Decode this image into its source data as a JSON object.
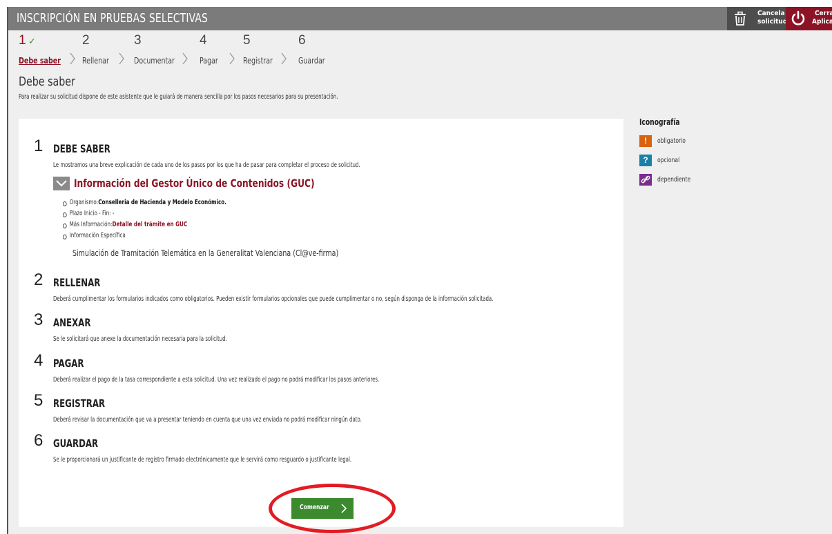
{
  "app": {
    "title": "INSCRIPCIÓN EN PRUEBAS SELECTIVAS",
    "cancel_label_1": "Cancela",
    "cancel_label_2": "solicitud",
    "close_label_1": "Cerrar",
    "close_label_2": "Aplicación"
  },
  "steps": [
    {
      "number": "1",
      "name": "Debe saber",
      "done": true
    },
    {
      "number": "2",
      "name": "Rellenar"
    },
    {
      "number": "3",
      "name": "Documentar"
    },
    {
      "number": "4",
      "name": "Pagar"
    },
    {
      "number": "5",
      "name": "Registrar"
    },
    {
      "number": "6",
      "name": "Guardar"
    }
  ],
  "page": {
    "title": "Debe saber",
    "description": "Para realizar su solicitud dispone de este asistente que le guiará de manera sencilla por los pasos necesarios para su presentación."
  },
  "sections": [
    {
      "number": "1",
      "title": "DEBE SABER",
      "description": "Le mostramos una breve explicación de cada uno de los pasos por los que ha de pasar para completar el proceso de solicitud."
    },
    {
      "number": "2",
      "title": "RELLENAR",
      "description": "Deberá cumplimentar los formularios indicados como obligatorios. Pueden existir formularios opcionales que puede cumplimentar o no, según disponga de la información solicitada."
    },
    {
      "number": "3",
      "title": "ANEXAR",
      "description": "Se le solicitará que anexe la documentación necesaria para la solicitud."
    },
    {
      "number": "4",
      "title": "PAGAR",
      "description": "Deberá realizar el pago de la tasa correspondiente a esta solicitud. Una vez realizado el pago no podrá modificar los pasos anteriores."
    },
    {
      "number": "5",
      "title": "REGISTRAR",
      "description": "Deberá revisar la documentación que va a presentar teniendo en cuenta que una vez enviada no podrá modificar ningún dato."
    },
    {
      "number": "6",
      "title": "GUARDAR",
      "description": "Se le proporcionará un justificante de registro firmado electrónicamente que le servirá como resguardo o justificante legal."
    }
  ],
  "guc": {
    "title": "Información del Gestor Único de Contenidos (GUC)",
    "organismo_label": "Organismo:",
    "organismo_value": "Conselleria de Hacienda y Modelo Económico.",
    "plazo": "Plazo Inicio - Fin: -",
    "mas_info_label": "Más Información:",
    "mas_info_link": "Detalle del trámite en GUC",
    "info_especifica": "Información Específica",
    "extra_text": "Simulación de Tramitación Telemática en la Generalitat Valenciana (Cl@ve-firma)"
  },
  "start_button": {
    "label": "Comenzar"
  },
  "legend": {
    "title": "Iconografía",
    "items": [
      {
        "symbol": "!",
        "label": "obligatorio",
        "color": "#d9620f"
      },
      {
        "symbol": "?",
        "label": "opcional",
        "color": "#1c7fa6"
      },
      {
        "symbol": "link",
        "label": "dependiente",
        "color": "#7a2b8c"
      }
    ]
  },
  "colors": {
    "topbar": "#7b7b7b",
    "accent": "#8b1325",
    "start_button": "#3b8a2e",
    "highlight": "#e31b23"
  }
}
